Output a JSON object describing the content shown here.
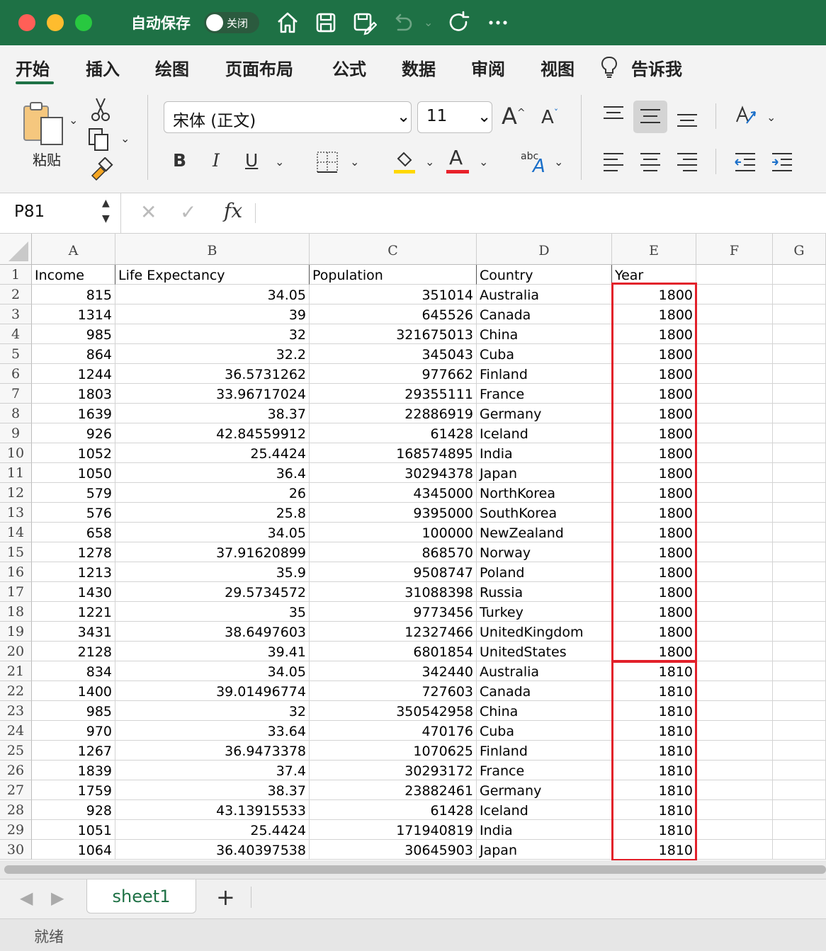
{
  "titlebar": {
    "autosave_label": "自动保存",
    "autosave_toggle": "关闭"
  },
  "ribbon_tabs": [
    "开始",
    "插入",
    "绘图",
    "页面布局",
    "公式",
    "数据",
    "审阅",
    "视图",
    "告诉我"
  ],
  "ribbon": {
    "paste_label": "粘贴",
    "font_name": "宋体 (正文)",
    "font_size": "11",
    "bold": "B",
    "italic": "I",
    "underline": "U",
    "font_color_letter": "A",
    "wrap_label": "abc"
  },
  "formula_bar": {
    "cell_ref": "P81",
    "fx": "fx",
    "value": ""
  },
  "columns": [
    "A",
    "B",
    "C",
    "D",
    "E",
    "F",
    "G"
  ],
  "header_row": [
    "Income",
    "Life Expectancy",
    "Population",
    "Country",
    "Year"
  ],
  "rows": [
    [
      "815",
      "34.05",
      "351014",
      "Australia",
      "1800"
    ],
    [
      "1314",
      "39",
      "645526",
      "Canada",
      "1800"
    ],
    [
      "985",
      "32",
      "321675013",
      "China",
      "1800"
    ],
    [
      "864",
      "32.2",
      "345043",
      "Cuba",
      "1800"
    ],
    [
      "1244",
      "36.5731262",
      "977662",
      "Finland",
      "1800"
    ],
    [
      "1803",
      "33.96717024",
      "29355111",
      "France",
      "1800"
    ],
    [
      "1639",
      "38.37",
      "22886919",
      "Germany",
      "1800"
    ],
    [
      "926",
      "42.84559912",
      "61428",
      "Iceland",
      "1800"
    ],
    [
      "1052",
      "25.4424",
      "168574895",
      "India",
      "1800"
    ],
    [
      "1050",
      "36.4",
      "30294378",
      "Japan",
      "1800"
    ],
    [
      "579",
      "26",
      "4345000",
      "NorthKorea",
      "1800"
    ],
    [
      "576",
      "25.8",
      "9395000",
      "SouthKorea",
      "1800"
    ],
    [
      "658",
      "34.05",
      "100000",
      "NewZealand",
      "1800"
    ],
    [
      "1278",
      "37.91620899",
      "868570",
      "Norway",
      "1800"
    ],
    [
      "1213",
      "35.9",
      "9508747",
      "Poland",
      "1800"
    ],
    [
      "1430",
      "29.5734572",
      "31088398",
      "Russia",
      "1800"
    ],
    [
      "1221",
      "35",
      "9773456",
      "Turkey",
      "1800"
    ],
    [
      "3431",
      "38.6497603",
      "12327466",
      "UnitedKingdom",
      "1800"
    ],
    [
      "2128",
      "39.41",
      "6801854",
      "UnitedStates",
      "1800"
    ],
    [
      "834",
      "34.05",
      "342440",
      "Australia",
      "1810"
    ],
    [
      "1400",
      "39.01496774",
      "727603",
      "Canada",
      "1810"
    ],
    [
      "985",
      "32",
      "350542958",
      "China",
      "1810"
    ],
    [
      "970",
      "33.64",
      "470176",
      "Cuba",
      "1810"
    ],
    [
      "1267",
      "36.9473378",
      "1070625",
      "Finland",
      "1810"
    ],
    [
      "1839",
      "37.4",
      "30293172",
      "France",
      "1810"
    ],
    [
      "1759",
      "38.37",
      "23882461",
      "Germany",
      "1810"
    ],
    [
      "928",
      "43.13915533",
      "61428",
      "Iceland",
      "1810"
    ],
    [
      "1051",
      "25.4424",
      "171940819",
      "India",
      "1810"
    ],
    [
      "1064",
      "36.40397538",
      "30645903",
      "Japan",
      "1810"
    ]
  ],
  "sheet_tabs": [
    "sheet1"
  ],
  "add_sheet": "+",
  "status": "就绪",
  "colors": {
    "accent": "#1e7145",
    "highlight_border": "#e2202a",
    "fill_yellow": "#ffd800",
    "font_red": "#e8212a"
  }
}
